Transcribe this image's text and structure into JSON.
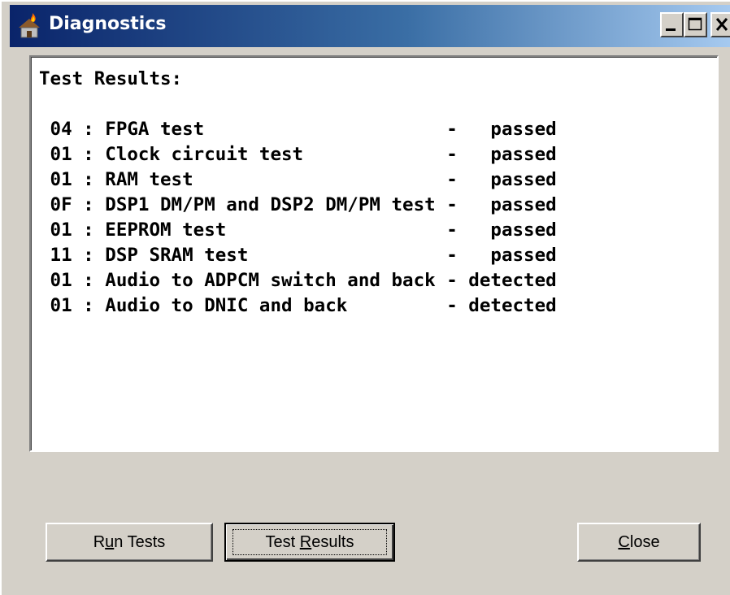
{
  "window": {
    "title": "Diagnostics",
    "icon": "house-flame-icon",
    "controls": [
      "minimize-icon",
      "maximize-icon",
      "close-icon"
    ]
  },
  "output": {
    "lines": [
      "Test Results:",
      "",
      " 04 : FPGA test                      -   passed",
      " 01 : Clock circuit test             -   passed",
      " 01 : RAM test                       -   passed",
      " 0F : DSP1 DM/PM and DSP2 DM/PM test -   passed",
      " 01 : EEPROM test                    -   passed",
      " 11 : DSP SRAM test                  -   passed",
      " 01 : Audio to ADPCM switch and back - detected",
      " 01 : Audio to DNIC and back         - detected"
    ]
  },
  "buttons": {
    "run_tests": {
      "pre": "R",
      "mnemonic": "u",
      "post": "n Tests"
    },
    "test_results": {
      "pre": "Test ",
      "mnemonic": "R",
      "post": "esults"
    },
    "close": {
      "pre": "",
      "mnemonic": "C",
      "post": "lose"
    }
  }
}
